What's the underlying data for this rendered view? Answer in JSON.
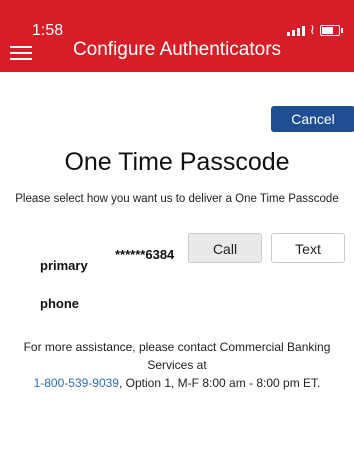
{
  "status_bar": {
    "time": "1:58"
  },
  "header": {
    "title": "Configure Authenticators"
  },
  "actions": {
    "cancel_label": "Cancel"
  },
  "main": {
    "heading": "One Time Passcode",
    "instructions": "Please select how you want us to deliver a One Time Passcode",
    "contact_row": {
      "label": "primary phone",
      "number": "******6384",
      "call_label": "Call",
      "text_label": "Text"
    }
  },
  "assistance": {
    "line1": "For more assistance, please contact Commercial Banking Services at",
    "phone": "1-800-539-9039",
    "line2": ", Option 1, M-F 8:00 am - 8:00 pm ET."
  },
  "colors": {
    "brand_red": "#d71e28",
    "cancel_blue": "#1f4f92",
    "link_blue": "#2a6db5"
  },
  "icons": [
    "menu-icon",
    "signal-icon",
    "wifi-icon",
    "battery-icon"
  ]
}
